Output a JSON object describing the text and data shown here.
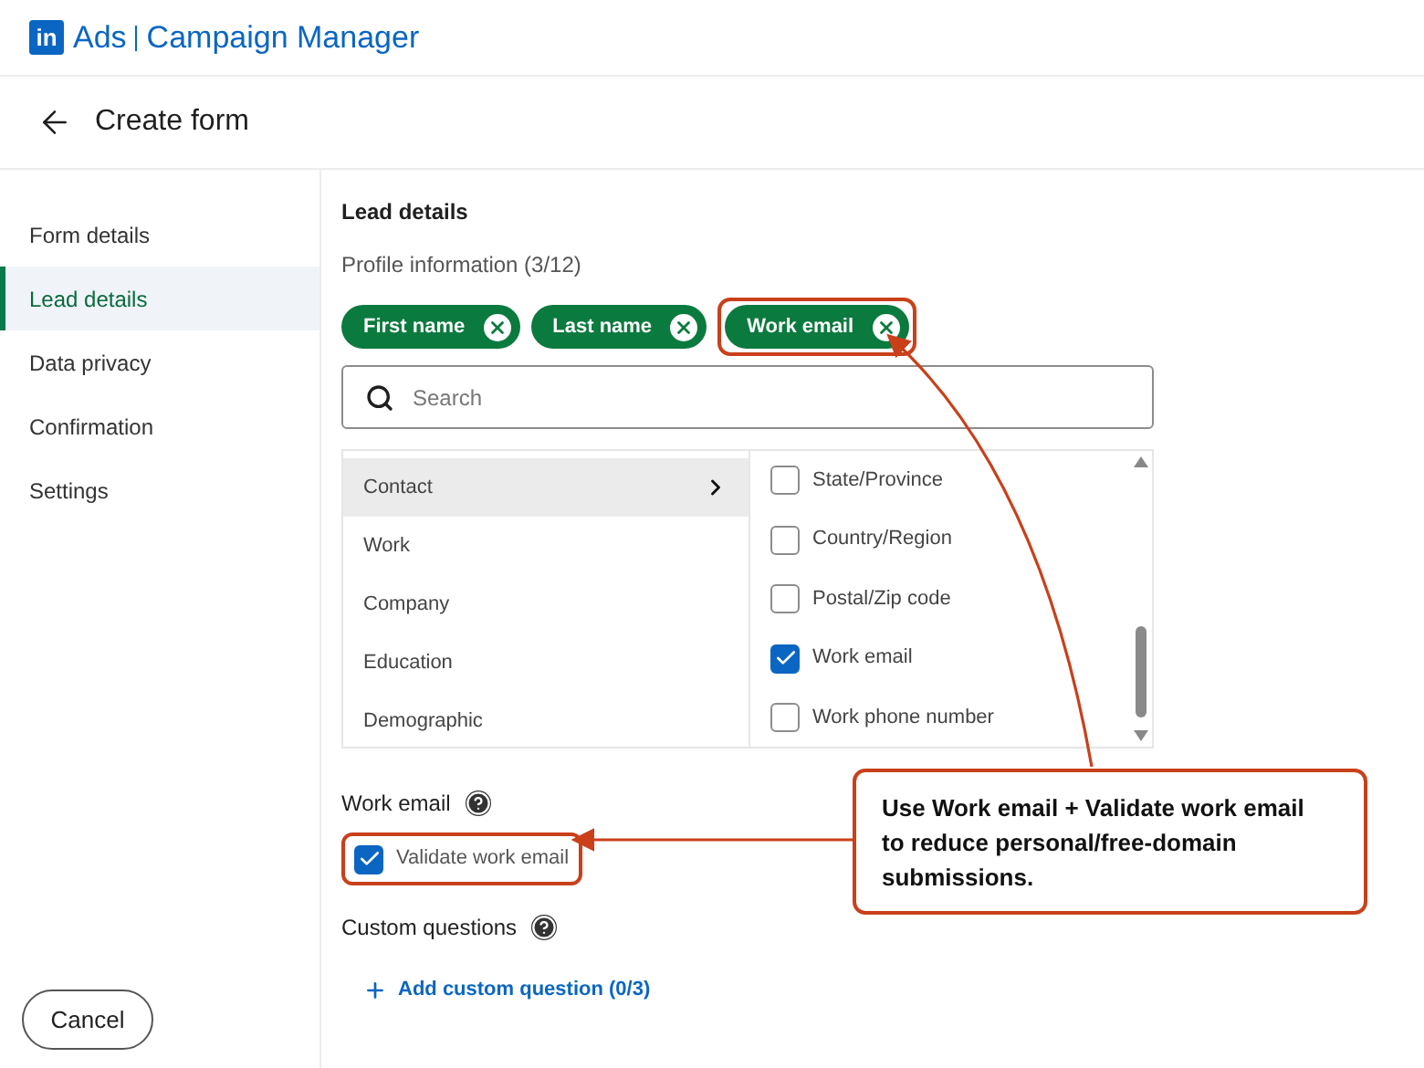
{
  "brand": {
    "logo": "in",
    "product": "Ads",
    "app": "Campaign Manager"
  },
  "page": {
    "title": "Create form"
  },
  "sidebar": {
    "items": [
      {
        "label": "Form details",
        "selected": false
      },
      {
        "label": "Lead details",
        "selected": true
      },
      {
        "label": "Data privacy",
        "selected": false
      },
      {
        "label": "Confirmation",
        "selected": false
      },
      {
        "label": "Settings",
        "selected": false
      }
    ]
  },
  "section": {
    "title": "Lead details",
    "subtitle": "Profile information (3/12)"
  },
  "chips": [
    {
      "label": "First name",
      "highlighted": false
    },
    {
      "label": "Last name",
      "highlighted": false
    },
    {
      "label": "Work email",
      "highlighted": true
    }
  ],
  "search": {
    "placeholder": "Search"
  },
  "categories": [
    {
      "label": "Contact",
      "selected": true
    },
    {
      "label": "Work",
      "selected": false
    },
    {
      "label": "Company",
      "selected": false
    },
    {
      "label": "Education",
      "selected": false
    },
    {
      "label": "Demographic",
      "selected": false
    }
  ],
  "fields": [
    {
      "label": "State/Province",
      "checked": false
    },
    {
      "label": "Country/Region",
      "checked": false
    },
    {
      "label": "Postal/Zip code",
      "checked": false
    },
    {
      "label": "Work email",
      "checked": true
    },
    {
      "label": "Work phone number",
      "checked": false
    }
  ],
  "work_email": {
    "title": "Work email",
    "validate": {
      "label": "Validate work email",
      "checked": true,
      "highlighted": true
    }
  },
  "custom_questions": {
    "title": "Custom questions",
    "add_link": "Add custom question (0/3)"
  },
  "callout": {
    "text": "Use Work email + Validate work email to reduce personal/free-domain submissions."
  },
  "footer": {
    "cancel": "Cancel"
  }
}
